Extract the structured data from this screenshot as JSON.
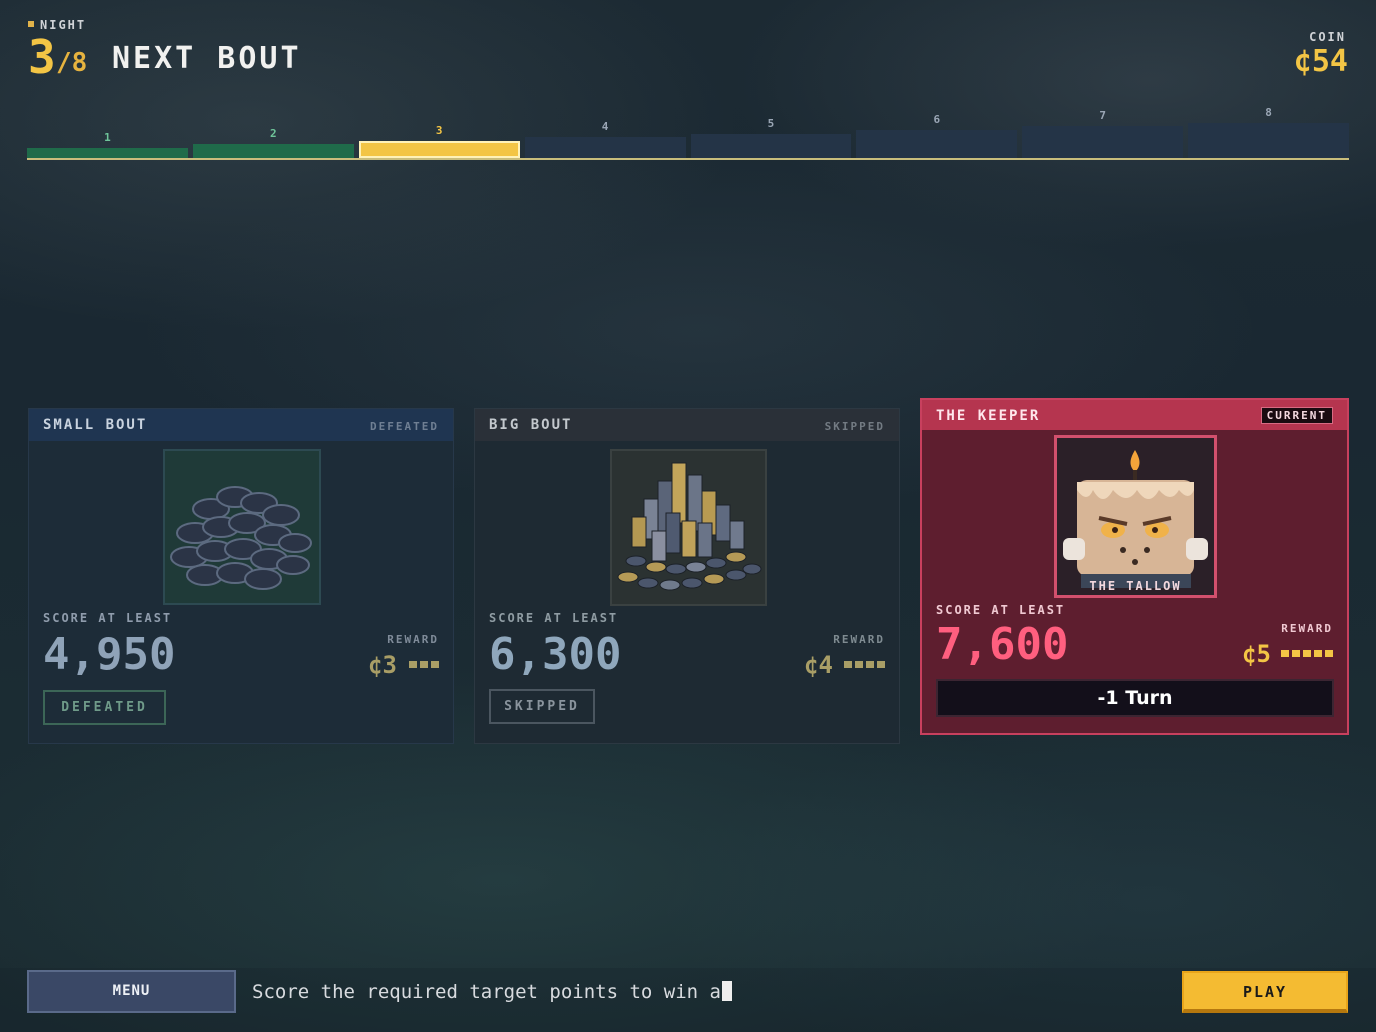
{
  "header": {
    "night_label": "NIGHT",
    "night_current": "3",
    "night_total": "/8",
    "title": "NEXT BOUT",
    "coin_label": "COIN",
    "coin_value": "¢54"
  },
  "track": {
    "segments": [
      {
        "label": "1",
        "state": "done"
      },
      {
        "label": "2",
        "state": "done"
      },
      {
        "label": "3",
        "state": "current"
      },
      {
        "label": "4",
        "state": "upcoming"
      },
      {
        "label": "5",
        "state": "upcoming"
      },
      {
        "label": "6",
        "state": "upcoming"
      },
      {
        "label": "7",
        "state": "upcoming"
      },
      {
        "label": "8",
        "state": "upcoming"
      }
    ]
  },
  "cards": {
    "small": {
      "title": "SMALL BOUT",
      "status": "DEFEATED",
      "art_icon": "dark-chip-pile",
      "score_label": "SCORE AT LEAST",
      "score_value": "4,950",
      "reward_label": "REWARD",
      "reward_value": "¢3",
      "reward_pips": 3,
      "state_button": "DEFEATED"
    },
    "big": {
      "title": "BIG BOUT",
      "status": "SKIPPED",
      "art_icon": "large-chip-pile",
      "score_label": "SCORE AT LEAST",
      "score_value": "6,300",
      "reward_label": "REWARD",
      "reward_value": "¢4",
      "reward_pips": 4,
      "state_button": "SKIPPED"
    },
    "keeper": {
      "title": "THE KEEPER",
      "badge": "CURRENT",
      "art_icon": "candle-monster",
      "art_caption": "THE TALLOW",
      "score_label": "SCORE AT LEAST",
      "score_value": "7,600",
      "reward_label": "REWARD",
      "reward_value": "¢5",
      "reward_pips": 5,
      "effect": "-1 Turn"
    }
  },
  "bottom": {
    "menu_label": "MENU",
    "hint": "Score the required target points to win a",
    "play_label": "PLAY"
  },
  "colors": {
    "gold": "#f3c545",
    "done": "#1f6b4a",
    "current": "#f3c545",
    "upcoming": "#243447",
    "keeper": "#b5354f"
  }
}
